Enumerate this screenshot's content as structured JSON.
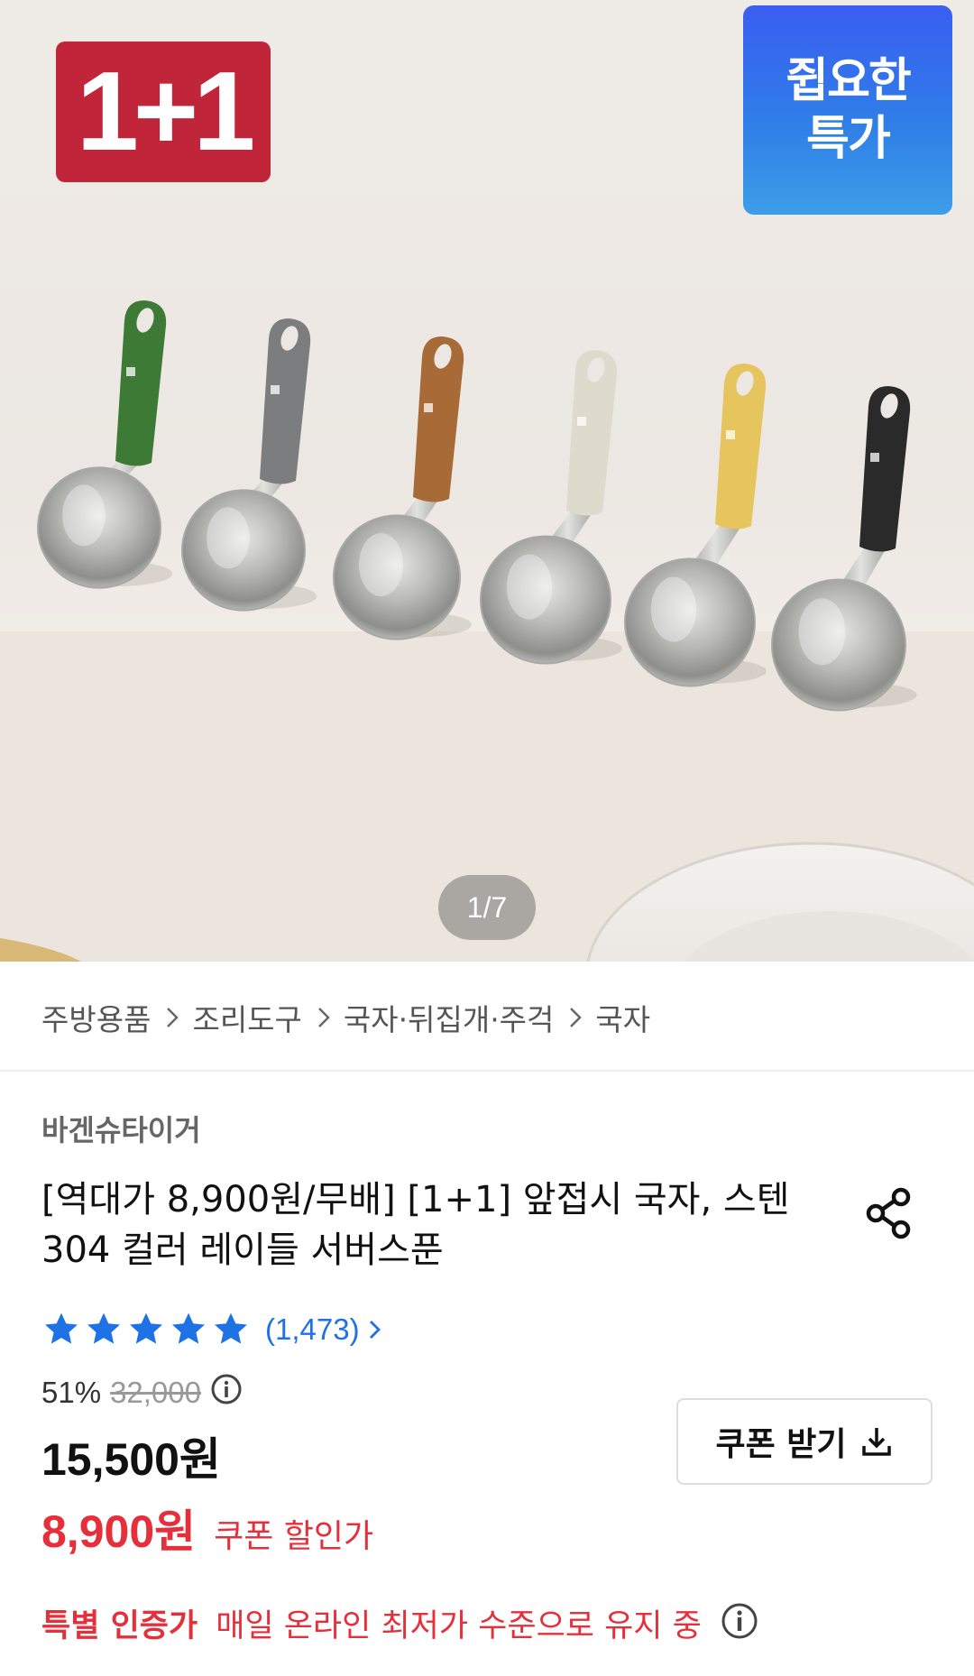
{
  "hero": {
    "badge_promo": "1+1",
    "badge_deal_line1": "쥡요한",
    "badge_deal_line2": "특가",
    "image_counter": "1/7",
    "handle_colors": [
      "#3d7a36",
      "#7b7d7f",
      "#a86a36",
      "#dedbcc",
      "#e6c45e",
      "#2a2a2a"
    ]
  },
  "breadcrumb": {
    "items": [
      "주방용품",
      "조리도구",
      "국자·뒤집개·주걱",
      "국자"
    ]
  },
  "product": {
    "brand": "바겐슈타이거",
    "title": "[역대가 8,900원/무배] [1+1] 앞접시 국자, 스텐304 컬러 레이들 서버스푼",
    "rating_stars": 5,
    "review_count": "(1,473)",
    "discount_rate": "51%",
    "original_price": "32,000",
    "sale_price": "15,500원",
    "coupon_price": "8,900원",
    "coupon_price_label": "쿠폰 할인가",
    "coupon_button_label": "쿠폰 받기",
    "cert_name": "특별 인증가",
    "cert_desc": "매일 온라인 최저가 수준으로 유지 중"
  },
  "colors": {
    "accent_red": "#e5303c",
    "link_blue": "#1f72e6",
    "star_blue": "#1f72e6"
  }
}
